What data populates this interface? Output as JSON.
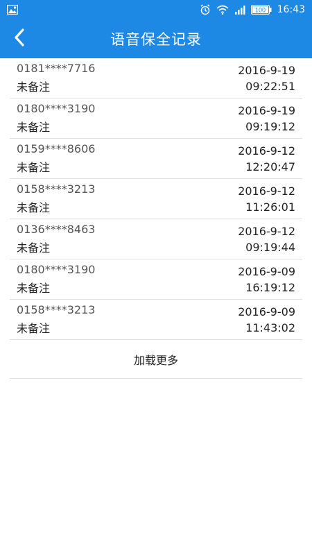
{
  "status_bar": {
    "left_icon": "image-icon",
    "right_icons": [
      "alarm-icon",
      "wifi-icon",
      "signal-icon",
      "battery-icon"
    ],
    "battery_percent": "100",
    "time": "16:43"
  },
  "app_bar": {
    "back_icon": "chevron-left-icon",
    "title": "语音保全记录"
  },
  "records": [
    {
      "phone": "0181****7716",
      "remark": "未备注",
      "date": "2016-9-19",
      "time": "09:22:51"
    },
    {
      "phone": "0180****3190",
      "remark": "未备注",
      "date": "2016-9-19",
      "time": "09:19:12"
    },
    {
      "phone": "0159****8606",
      "remark": "未备注",
      "date": "2016-9-12",
      "time": "12:20:47"
    },
    {
      "phone": "0158****3213",
      "remark": "未备注",
      "date": "2016-9-12",
      "time": "11:26:01"
    },
    {
      "phone": "0136****8463",
      "remark": "未备注",
      "date": "2016-9-12",
      "time": "09:19:44"
    },
    {
      "phone": "0180****3190",
      "remark": "未备注",
      "date": "2016-9-09",
      "time": "16:19:12"
    },
    {
      "phone": "0158****3213",
      "remark": "未备注",
      "date": "2016-9-09",
      "time": "11:43:02"
    }
  ],
  "load_more_label": "加载更多",
  "colors": {
    "primary": "#1e88e5",
    "divider": "#e1e1e1",
    "text_primary": "#222222",
    "text_secondary": "#555555"
  }
}
